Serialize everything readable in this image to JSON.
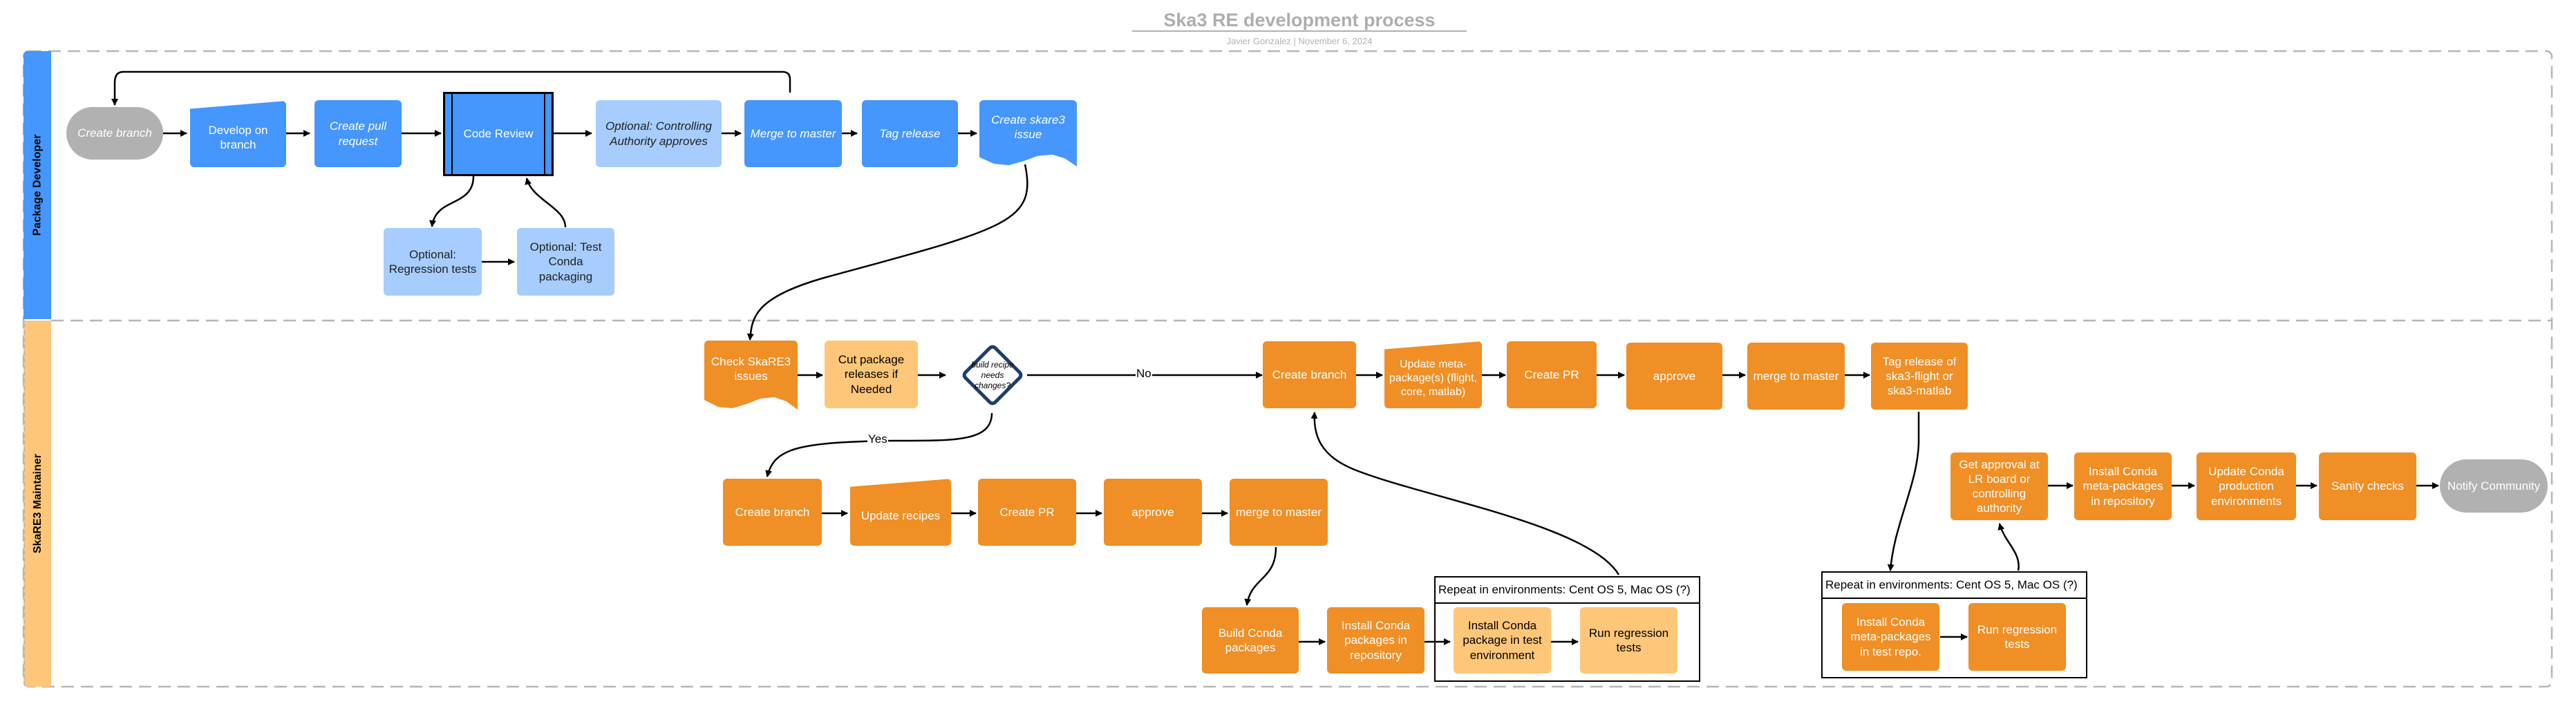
{
  "header": {
    "title": "Ska3 RE development process",
    "author": "Javier Gonzalez",
    "separator": "|",
    "date": "November 6, 2024"
  },
  "lanes": {
    "developer": {
      "label": "Package Developer",
      "color": "#4596fd"
    },
    "maintainer": {
      "label": "SkaRE3 Maintainer",
      "color": "#fec678"
    }
  },
  "developer_nodes": {
    "create_branch": "Create branch",
    "develop_on_branch": "Develop on branch",
    "create_pull_request": "Create pull request",
    "code_review": "Code Review",
    "controlling_authority": "Optional: Controlling Authority approves",
    "merge_to_master": "Merge to master",
    "tag_release": "Tag release",
    "create_skare3_issue": "Create skare3 issue",
    "regression_tests": "Optional: Regression tests",
    "test_conda_packaging": "Optional: Test Conda packaging"
  },
  "maintainer_nodes": {
    "check_issues": "Check SkaRE3 issues",
    "cut_releases": "Cut package releases if Needed",
    "decision": "build recipe needs changes?",
    "create_branch_top": "Create branch",
    "update_meta": "Update meta-package(s) (flight, core, matlab)",
    "create_pr_top": "Create PR",
    "approve_top": "approve",
    "merge_top": "merge to master",
    "tag_release_flight": "Tag release of ska3-flight or ska3-matlab",
    "create_branch_bottom": "Create branch",
    "update_recipes": "Update recipes",
    "create_pr_bottom": "Create PR",
    "approve_bottom": "approve",
    "merge_bottom": "merge to master",
    "build_conda": "Build Conda packages",
    "install_conda_repo": "Install Conda packages in repository",
    "install_conda_test": "Install Conda package in test environment",
    "run_regression_1": "Run regression tests",
    "get_approval": "Get approval at LR board or controlling authority",
    "install_meta_repo": "Install Conda meta-packages in repository",
    "update_production": "Update Conda production environments",
    "sanity_checks": "Sanity checks",
    "notify_community": "Notify Community",
    "install_meta_test": "Install Conda meta-packages in test repo.",
    "run_regression_2": "Run regression tests"
  },
  "containers": {
    "repeat_1": "Repeat in environments: Cent OS 5, Mac OS (?)",
    "repeat_2": "Repeat in environments: Cent OS 5, Mac OS (?)"
  },
  "edge_labels": {
    "no": "No",
    "yes": "Yes"
  },
  "colors": {
    "developer_blue": "#4596fd",
    "optional_light_blue": "#a6cdfd",
    "maintainer_orange": "#ef8f25",
    "maintainer_light_orange": "#fec678",
    "terminator_grey": "#b1b1b1",
    "decision_border": "#1d3d6c"
  }
}
